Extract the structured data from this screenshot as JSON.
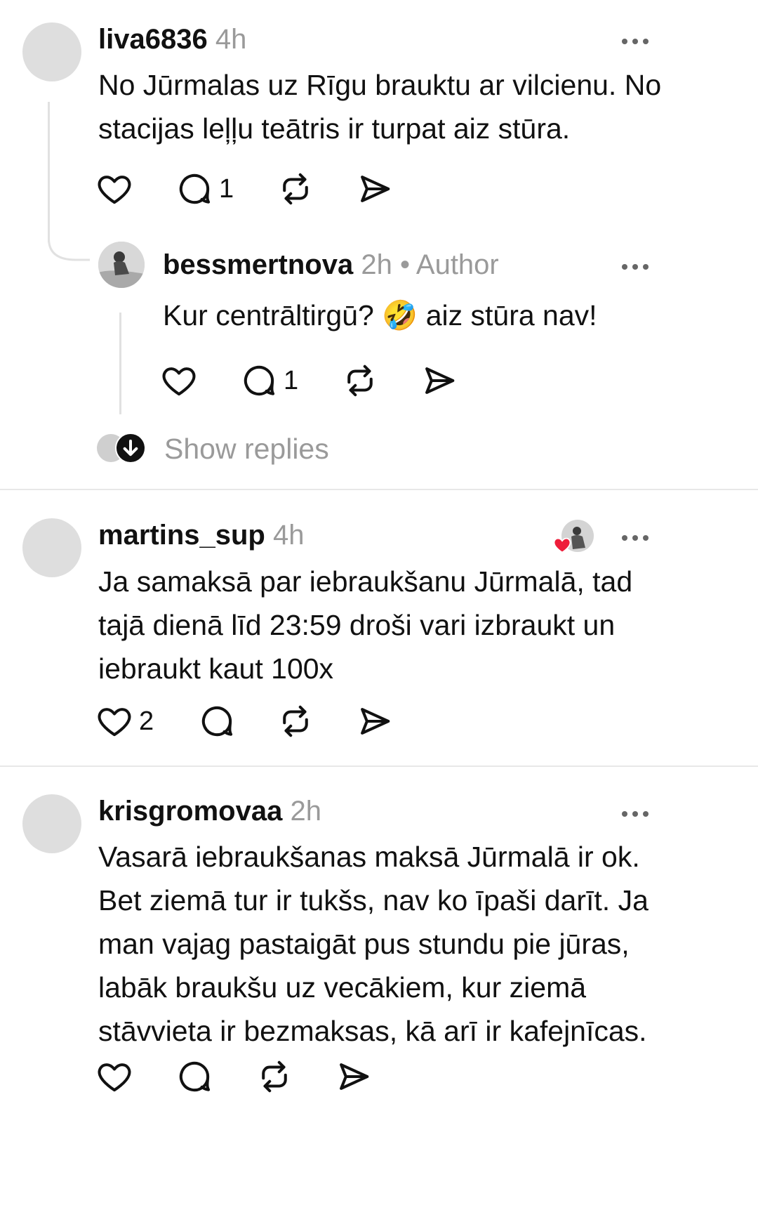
{
  "comments": [
    {
      "username": "liva6836",
      "time": "4h",
      "text_lines": [
        "No Jūrmalas uz Rīgu brauktu ar vilcienu. No",
        "stacijas leļļu teātris ir turpat aiz stūra."
      ],
      "reply_count": "1"
    },
    {
      "username": "martins_sup",
      "time": "4h",
      "text_lines": [
        "Ja samaksā par iebraukšanu Jūrmalā, tad",
        "tajā dienā līd 23:59 droši vari izbraukt un",
        "iebraukt kaut 100x"
      ],
      "like_count": "2"
    },
    {
      "username": "krisgromovaa",
      "time": "2h",
      "text_lines": [
        "Vasarā iebraukšanas maksā Jūrmalā ir ok.",
        "Bet ziemā tur ir tukšs, nav ko īpaši darīt. Ja",
        "man vajag pastaigāt pus stundu pie jūras,",
        "labāk braukšu uz vecākiem, kur ziemā",
        "stāvvieta ir bezmaksas, kā arī ir kafejnīcas."
      ]
    }
  ],
  "reply": {
    "username": "bessmertnova",
    "time": "2h",
    "badge": "• Author",
    "text_before": "Kur centrāltirgū?",
    "emoji": "🤣",
    "text_after": "aiz stūra nav!",
    "reply_count": "1"
  },
  "show_replies_label": "Show replies",
  "icons": {
    "like": "heart-icon",
    "comment": "comment-icon",
    "repost": "repost-icon",
    "share": "send-icon",
    "more": "more-icon"
  }
}
